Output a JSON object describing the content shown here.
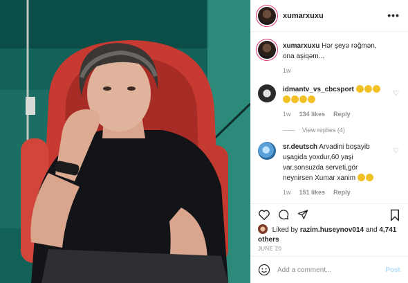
{
  "header": {
    "username": "xumarxuxu",
    "more_icon": "more-horizontal-icon"
  },
  "caption": {
    "username": "xumarxuxu",
    "text": "Hər şeyə rəğmən, ona aşiqəm...",
    "age": "1w"
  },
  "comments": [
    {
      "username": "idmantv_vs_cbcsport",
      "text": "",
      "emoji_count_line1": 3,
      "emoji_count_line2": 4,
      "age": "1w",
      "likes": "134 likes",
      "reply": "Reply",
      "view_replies": "View replies (4)"
    },
    {
      "username": "sr.deutsch",
      "text": "Arvadini boşayib uşagida yoxdur,60 yaşi var,sonsuzda serveti,gör neynirsen Xumar xanim",
      "age": "1w",
      "likes": "151 likes",
      "reply": "Reply"
    }
  ],
  "liked_by": {
    "prefix": "Liked by",
    "user": "razim.huseynov014",
    "and": "and",
    "others": "4,741 others"
  },
  "date": "JUNE 20",
  "add_comment": {
    "placeholder": "Add a comment...",
    "post_label": "Post"
  },
  "colors": {
    "accent_link": "#0095f6",
    "post_disabled": "#b2dffc",
    "ring": "#e1306c"
  }
}
